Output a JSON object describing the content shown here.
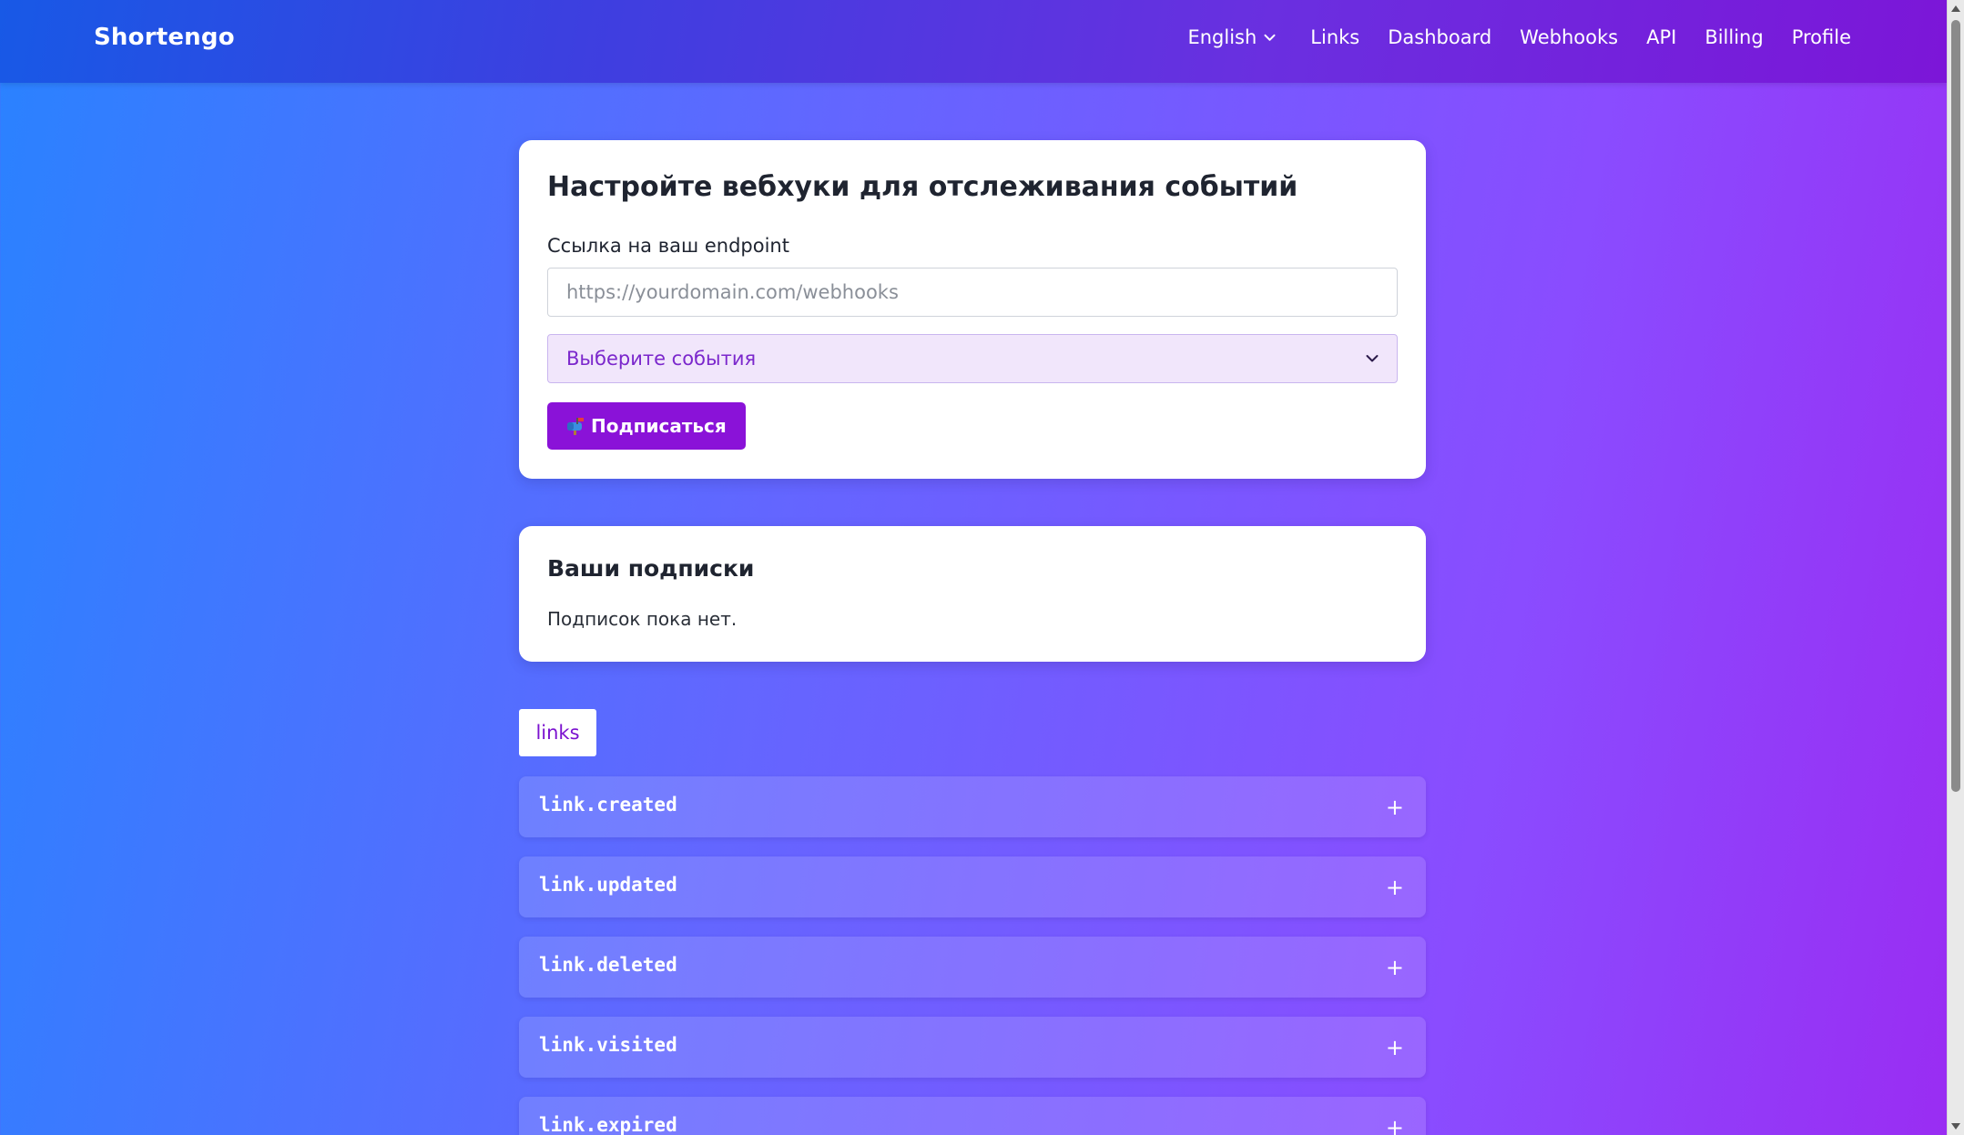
{
  "nav": {
    "brand": "Shortengo",
    "language": "English",
    "links": [
      "Links",
      "Dashboard",
      "Webhooks",
      "API",
      "Billing",
      "Profile"
    ]
  },
  "subscribe_card": {
    "title": "Настройте вебхуки для отслеживания событий",
    "endpoint_label": "Ссылка на ваш endpoint",
    "endpoint_placeholder": "https://yourdomain.com/webhooks",
    "endpoint_value": "",
    "events_select": "Выберите события",
    "subscribe_button": "Подписаться"
  },
  "subscriptions_card": {
    "title": "Ваши подписки",
    "empty_text": "Подписок пока нет."
  },
  "event_groups": {
    "active_tab": "links",
    "events": [
      "link.created",
      "link.updated",
      "link.deleted",
      "link.visited",
      "link.expired"
    ],
    "expand_symbol": "+"
  },
  "colors": {
    "accent": "#8a12d8",
    "select_bg": "#f1e6fb",
    "select_text": "#7b27cc"
  },
  "icons": {
    "language_dropdown": "chevron-down-icon",
    "events_dropdown": "chevron-down-icon",
    "subscribe": "mailbox-icon",
    "expand": "plus-icon"
  }
}
